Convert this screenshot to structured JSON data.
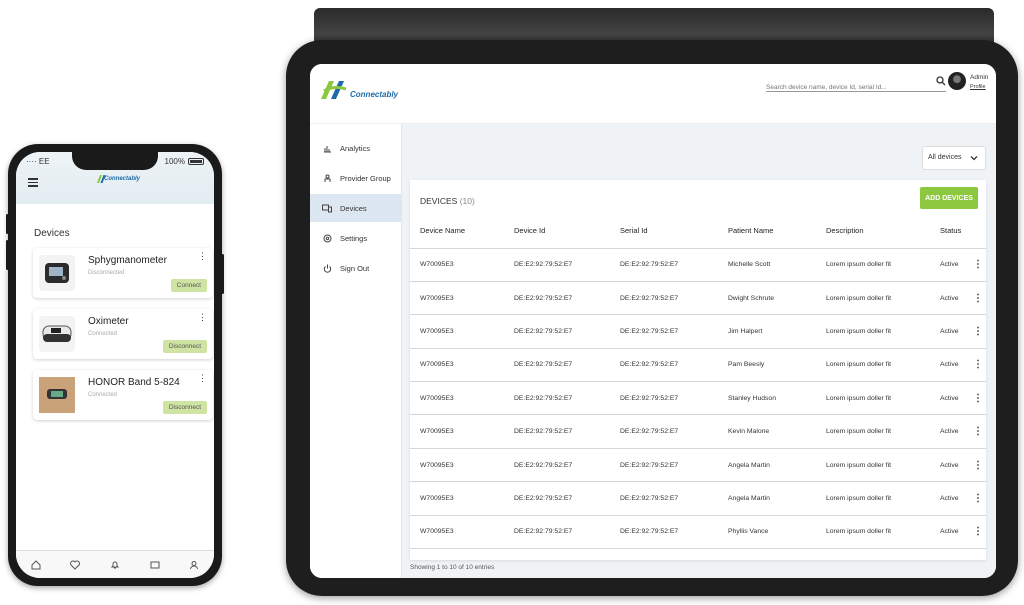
{
  "phone": {
    "status": {
      "carrier": "EE",
      "battery": "100%"
    },
    "logo_text": "Connectably",
    "section_title": "Devices",
    "devices": [
      {
        "name": "Sphygmanometer",
        "state": "Disconnected",
        "action": "Connect"
      },
      {
        "name": "Oximeter",
        "state": "Connected",
        "action": "Disconnect"
      },
      {
        "name": "HONOR Band 5-824",
        "state": "Connected",
        "action": "Disconnect"
      }
    ],
    "nav_icons": [
      "home-icon",
      "heart-icon",
      "bell-icon",
      "chat-icon",
      "user-icon"
    ]
  },
  "tablet": {
    "logo_text": "Connectably",
    "search_placeholder": "Search device name, device Id, serial Id...",
    "user": {
      "name": "Admin",
      "profile_link": "Profile"
    },
    "sidebar": [
      {
        "label": "Analytics",
        "icon": "chart-icon"
      },
      {
        "label": "Provider Group",
        "icon": "group-icon"
      },
      {
        "label": "Devices",
        "icon": "devices-icon",
        "active": true
      },
      {
        "label": "Settings",
        "icon": "settings-icon"
      },
      {
        "label": "Sign Out",
        "icon": "power-icon"
      }
    ],
    "filter": {
      "selected": "All devices"
    },
    "card": {
      "title": "DEVICES",
      "count": "(10)",
      "add_button": "ADD DEVICES"
    },
    "table": {
      "headers": [
        "Device Name",
        "Device Id",
        "Serial Id",
        "Patient Name",
        "Description",
        "Status"
      ],
      "rows": [
        [
          "W70095E3",
          "DE:E2:92:79:52:E7",
          "DE:E2:92:79:52:E7",
          "Michelle Scott",
          "Lorem ipsum doller fit",
          "Active"
        ],
        [
          "W70095E3",
          "DE:E2:92:79:52:E7",
          "DE:E2:92:79:52:E7",
          "Dwight Schrute",
          "Lorem ipsum doller fit",
          "Active"
        ],
        [
          "W70095E3",
          "DE:E2:92:79:52:E7",
          "DE:E2:92:79:52:E7",
          "Jim Halpert",
          "Lorem ipsum doller fit",
          "Active"
        ],
        [
          "W70095E3",
          "DE:E2:92:79:52:E7",
          "DE:E2:92:79:52:E7",
          "Pam Beesly",
          "Lorem ipsum doller fit",
          "Active"
        ],
        [
          "W70095E3",
          "DE:E2:92:79:52:E7",
          "DE:E2:92:79:52:E7",
          "Stanley Hudson",
          "Lorem ipsum doller fit",
          "Active"
        ],
        [
          "W70095E3",
          "DE:E2:92:79:52:E7",
          "DE:E2:92:79:52:E7",
          "Kevin Malone",
          "Lorem ipsum doller fit",
          "Active"
        ],
        [
          "W70095E3",
          "DE:E2:92:79:52:E7",
          "DE:E2:92:79:52:E7",
          "Angela Martin",
          "Lorem ipsum doller fit",
          "Active"
        ],
        [
          "W70095E3",
          "DE:E2:92:79:52:E7",
          "DE:E2:92:79:52:E7",
          "Angela Martin",
          "Lorem ipsum doller fit",
          "Active"
        ],
        [
          "W70095E3",
          "DE:E2:92:79:52:E7",
          "DE:E2:92:79:52:E7",
          "Phyllis Vance",
          "Lorem ipsum doller fit",
          "Active"
        ]
      ]
    },
    "footer": "Showing 1 to 10 of 10 entries"
  },
  "colors": {
    "accent_green": "#8dc63f",
    "brand_blue": "#1e6aa8",
    "active_nav": "#dde7f1",
    "button_soft_green": "#cfe3a2"
  }
}
